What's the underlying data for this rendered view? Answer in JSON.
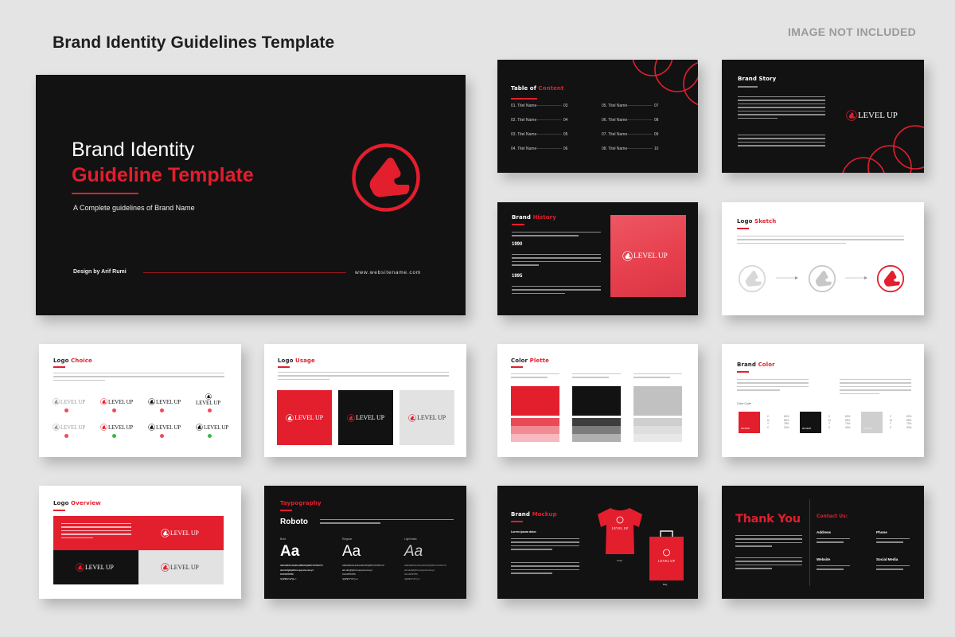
{
  "header": {
    "title": "Brand Identity Guidelines Template",
    "notice": "IMAGE NOT INCLUDED"
  },
  "colors": {
    "accent": "#e31e2d",
    "dark": "#121213",
    "light_gray": "#e4e4e4"
  },
  "brand": {
    "logo_text": "LEVEL UP",
    "logo_icon": "level-up-triangle-icon"
  },
  "cover": {
    "title_line1": "Brand Identity",
    "title_line2": "Guideline Template",
    "subtitle": "A Complete guidelines of Brand Name",
    "designer": "Design by Arif Rumi",
    "website": "www.websitename.com"
  },
  "toc": {
    "title_a": "Table of",
    "title_b": "Content",
    "items": [
      {
        "label": "01. Titel Name",
        "page": "03"
      },
      {
        "label": "02. Titel Name",
        "page": "04"
      },
      {
        "label": "03. Titel Name",
        "page": "05"
      },
      {
        "label": "04. Titel Name",
        "page": "06"
      },
      {
        "label": "05. Titel Name",
        "page": "07"
      },
      {
        "label": "06. Titel Name",
        "page": "08"
      },
      {
        "label": "07. Titel Name",
        "page": "09"
      },
      {
        "label": "08. Titel Name",
        "page": "10"
      }
    ]
  },
  "story": {
    "title": "Brand Story"
  },
  "history": {
    "title_a": "Brand",
    "title_b": "History",
    "years": [
      "1990",
      "1995"
    ]
  },
  "sketch": {
    "title_a": "Logo",
    "title_b": "Sketch"
  },
  "choice": {
    "title_a": "Logo",
    "title_b": "Choice",
    "variants": [
      {
        "style": "gray",
        "ok": false
      },
      {
        "style": "red",
        "ok": false
      },
      {
        "style": "black",
        "ok": false
      },
      {
        "style": "stacked",
        "ok": false
      },
      {
        "style": "gray",
        "ok": false
      },
      {
        "style": "red",
        "ok": true
      },
      {
        "style": "black",
        "ok": false
      },
      {
        "style": "black",
        "ok": true
      }
    ]
  },
  "usage": {
    "title_a": "Logo",
    "title_b": "Usage",
    "backgrounds": [
      "#e31e2d",
      "#121213",
      "#e2e2e2"
    ]
  },
  "palette": {
    "title_a": "Color",
    "title_b": "Plette",
    "columns": [
      {
        "main": "#e31e2d",
        "tints": [
          "#ea4a56",
          "#f28b93",
          "#f7b9bd"
        ]
      },
      {
        "main": "#121213",
        "tints": [
          "#3d3d3d",
          "#7c7c7c",
          "#b0b0b0"
        ]
      },
      {
        "main": "#c1c1c1",
        "tints": [
          "#cfcfcf",
          "#dedede",
          "#e8e8e8"
        ]
      }
    ]
  },
  "brand_color": {
    "title_a": "Brand",
    "title_b": "Color",
    "codes_label": "Color Code",
    "swatches": [
      {
        "color": "#e31e2d",
        "hex": "#FF0000",
        "cmyk_keys": [
          "C",
          "M",
          "Y",
          "C"
        ],
        "cmyk": [
          "60%",
          "85%",
          "78%",
          "30%"
        ]
      },
      {
        "color": "#121213",
        "hex": "#FF0000",
        "cmyk_keys": [
          "C",
          "M",
          "Y",
          "C"
        ],
        "cmyk": [
          "60%",
          "55%",
          "70%",
          "30%"
        ]
      },
      {
        "color": "#cfcfcf",
        "hex": "#FF0000",
        "cmyk_keys": [
          "C",
          "M",
          "Y",
          "C"
        ],
        "cmyk": [
          "60%",
          "55%",
          "70%",
          "30%"
        ]
      }
    ]
  },
  "overview": {
    "title_a": "Logo",
    "title_b": "Overview"
  },
  "typography": {
    "title": "Taypography",
    "font": "Roboto",
    "weights": [
      {
        "label": "Bold",
        "sample": "Aa"
      },
      {
        "label": "Regular",
        "sample": "Aa"
      },
      {
        "label": "Light Italic",
        "sample": "Aa"
      }
    ],
    "charset": [
      "ABCDEFGHIJKLMNOPQRSTUVWXYZ",
      "abcdefghijklmnopqrstuvwxyz",
      "0123456789",
      "!@#$%^&*()+="
    ]
  },
  "mockup": {
    "title_a": "Brand",
    "title_b": "Mockup",
    "subheading": "Lorem ipsum dolor",
    "items": [
      "Front",
      "Bag"
    ]
  },
  "thank": {
    "title": "Thank You",
    "contact_title": "Contact Us:",
    "fields": [
      "Address",
      "Phone",
      "Website",
      "Social Media"
    ]
  }
}
